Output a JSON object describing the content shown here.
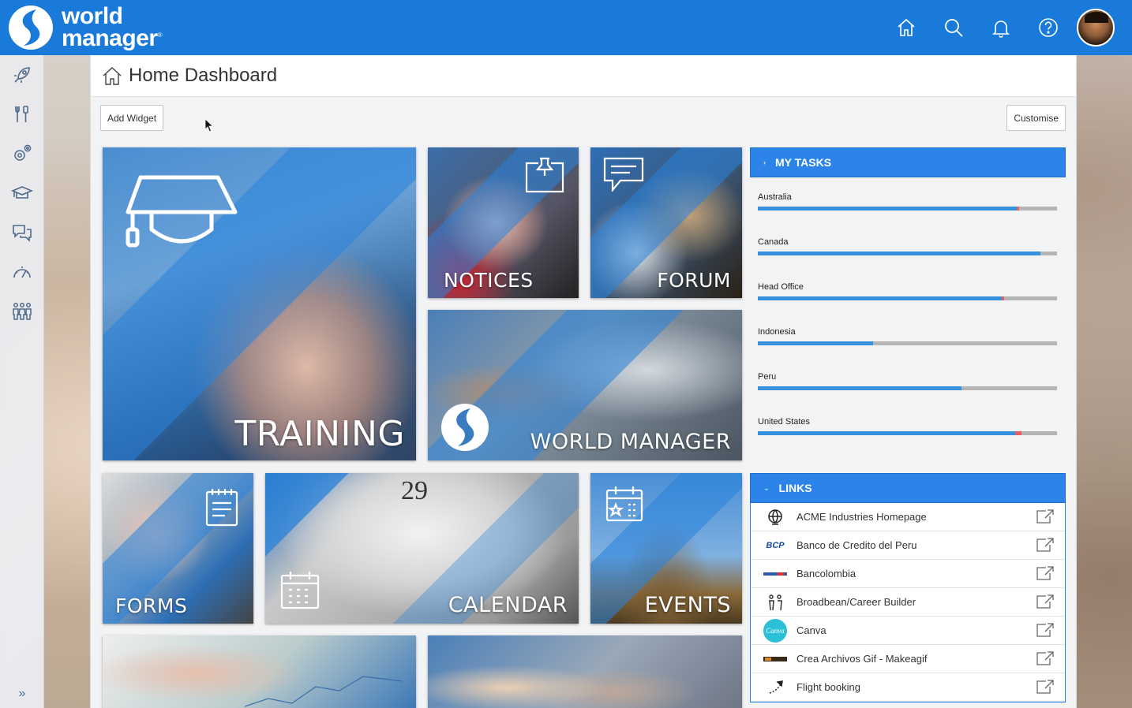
{
  "brand": {
    "line1": "world",
    "line2": "manager",
    "mark": "®"
  },
  "topbar": {
    "icons": [
      "home-icon",
      "search-icon",
      "bell-icon",
      "help-icon"
    ],
    "accent": "#1a7ad9"
  },
  "sidebar": {
    "items": [
      "rocket-icon",
      "tools-icon",
      "settings-icon",
      "training-icon",
      "chat-icon",
      "dashboard-gauge-icon",
      "people-icon"
    ],
    "expand": "»"
  },
  "header": {
    "title": "Home Dashboard"
  },
  "toolbar": {
    "add_widget": "Add Widget",
    "customise": "Customise"
  },
  "tiles": {
    "training": "TRAINING",
    "notices": "NOTICES",
    "forum": "FORUM",
    "world_manager": "WORLD MANAGER",
    "forms": "FORMS",
    "calendar": "CALENDAR",
    "calendar_day": "29",
    "events": "EVENTS"
  },
  "tasks": {
    "title": "MY TASKS",
    "rows": [
      {
        "name": "Australia",
        "complete": 0.865,
        "overdue": 0.008
      },
      {
        "name": "Canada",
        "complete": 0.945,
        "overdue": 0
      },
      {
        "name": "Head Office",
        "complete": 0.815,
        "overdue": 0.008
      },
      {
        "name": "Indonesia",
        "complete": 0.385,
        "overdue": 0
      },
      {
        "name": "Peru",
        "complete": 0.682,
        "overdue": 0
      },
      {
        "name": "United States",
        "complete": 0.86,
        "overdue": 0.02
      }
    ]
  },
  "links": {
    "title": "LINKS",
    "items": [
      {
        "label": "ACME Industries Homepage",
        "logo": "globe-logo"
      },
      {
        "label": "Banco de Credito del Peru",
        "logo": "BCP"
      },
      {
        "label": "Bancolombia",
        "logo": "bancolombia-logo"
      },
      {
        "label": "Broadbean/Career Builder",
        "logo": "people-logo"
      },
      {
        "label": "Canva",
        "logo": "Canva"
      },
      {
        "label": "Crea Archivos Gif - Makeagif",
        "logo": "makeagif-logo"
      },
      {
        "label": "Flight booking",
        "logo": "plane-logo"
      }
    ]
  }
}
